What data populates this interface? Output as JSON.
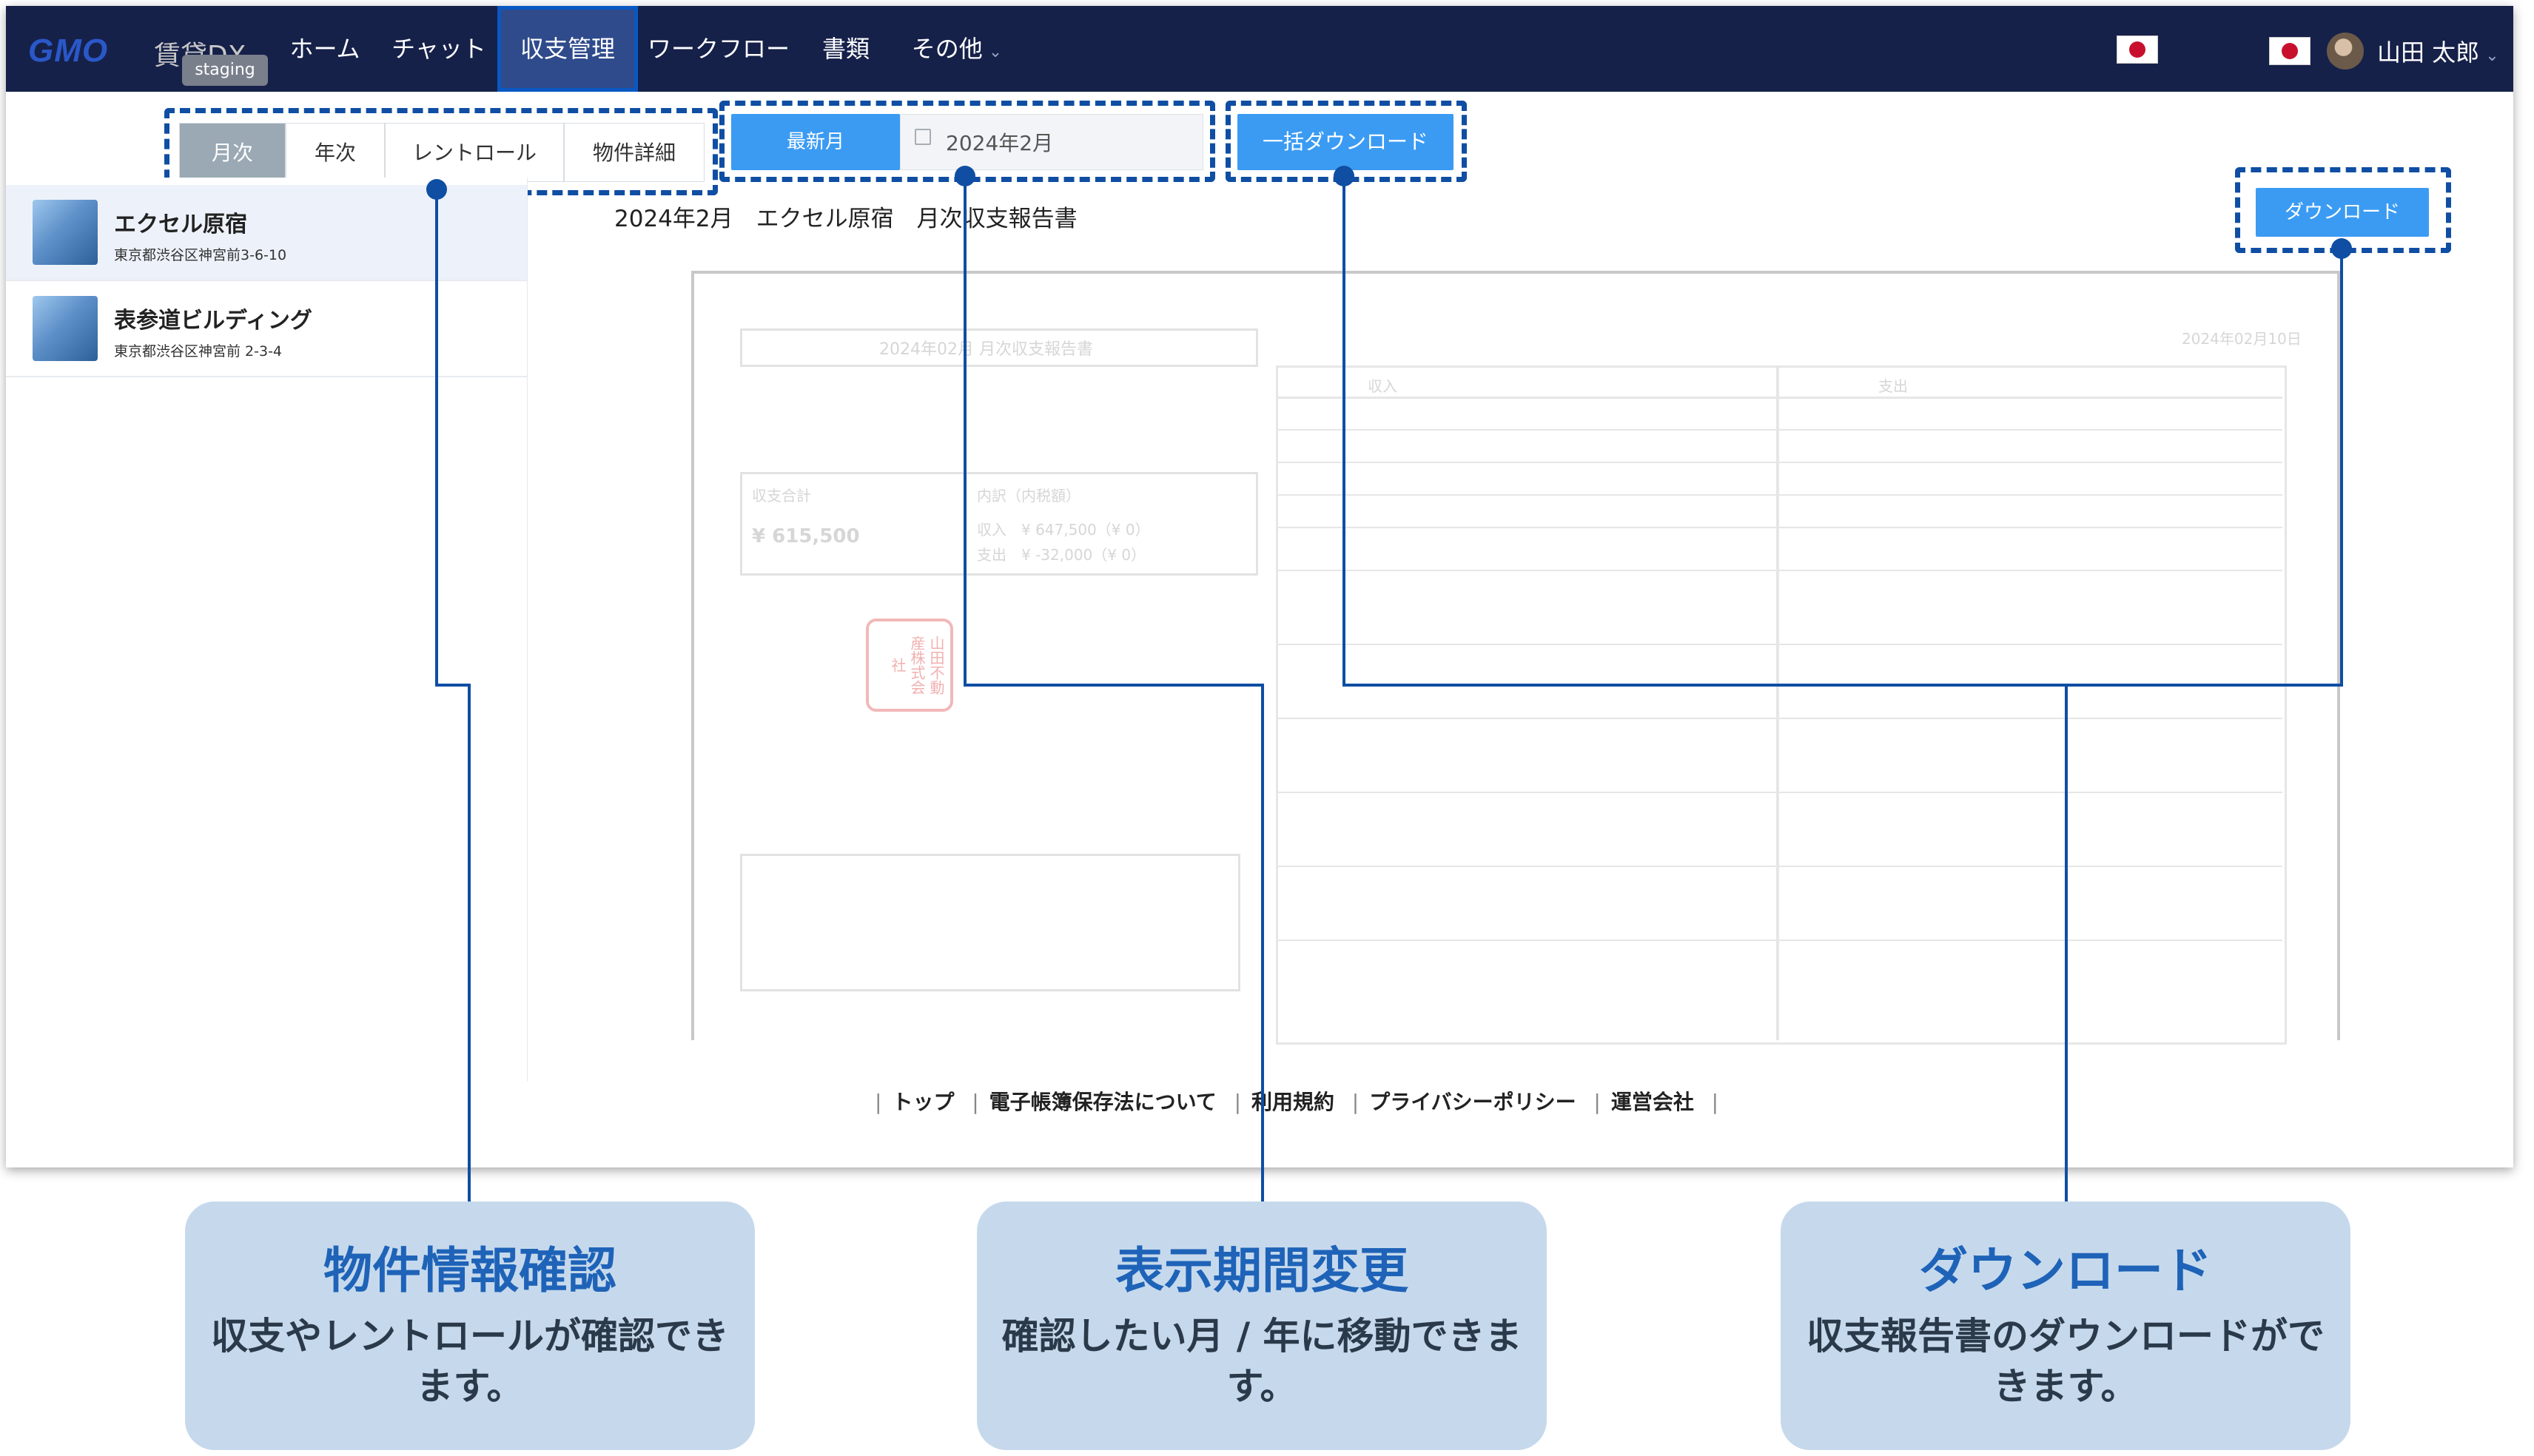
{
  "app": {
    "logo": "GMO",
    "brand": "賃貸DX",
    "env_badge": "staging"
  },
  "nav": {
    "items": [
      "ホーム",
      "チャット",
      "収支管理",
      "ワークフロー",
      "書類",
      "その他"
    ],
    "user_name": "山田 太郎"
  },
  "subtabs": [
    "月次",
    "年次",
    "レントロール",
    "物件詳細"
  ],
  "period": {
    "latest_label": "最新月",
    "date_value": "2024年2月"
  },
  "bulk_download_label": "一括ダウンロード",
  "download_label": "ダウンロード",
  "properties": [
    {
      "name": "エクセル原宿",
      "address": "東京都渋谷区神宮前3-6-10"
    },
    {
      "name": "表参道ビルディング",
      "address": "東京都渋谷区神宮前 2-3-4"
    }
  ],
  "report": {
    "title": "2024年2月　エクセル原宿　月次収支報告書",
    "doc_date": "2024年02月10日",
    "doc_heading": "2024年02月 月次収支報告書",
    "doc_total_label": "収支合計",
    "doc_total_value": "¥ 615,500",
    "doc_breakdown_label": "内訳（内税額）",
    "doc_income": "収入　¥ 647,500（¥ 0）",
    "doc_expense": "支出　¥ -32,000（¥ 0）",
    "doc_income_header": "収入",
    "doc_expense_header": "支出",
    "stamp": "山田不動産株式会社"
  },
  "footer": [
    "トップ",
    "電子帳簿保存法について",
    "利用規約",
    "プライバシーポリシー",
    "運営会社"
  ],
  "callouts": [
    {
      "title": "物件情報確認",
      "body": "収支やレントロールが確認できます。"
    },
    {
      "title": "表示期間変更",
      "body": "確認したい月 / 年に移動できます。"
    },
    {
      "title": "ダウンロード",
      "body": "収支報告書のダウンロードができます。"
    }
  ],
  "colors": {
    "nav_bg": "#16214a",
    "accent": "#3b9bf3",
    "callout_line": "#0f4ea3",
    "callout_card": "#c6d9ec"
  }
}
